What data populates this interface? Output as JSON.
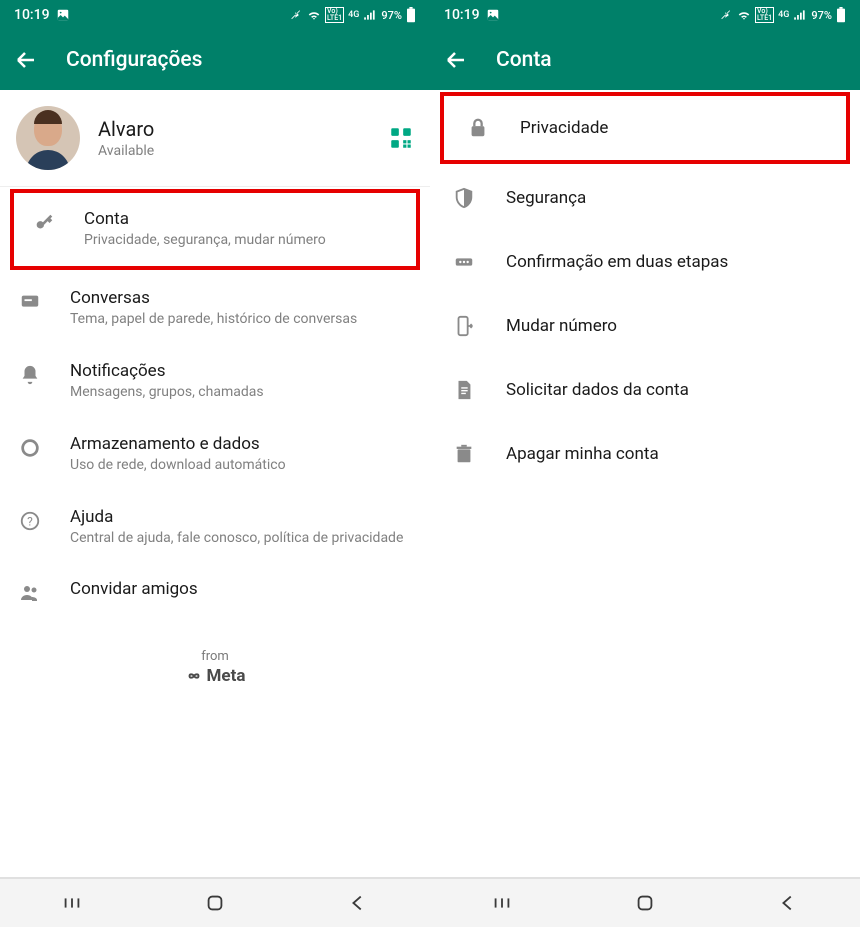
{
  "status": {
    "time": "10:19",
    "battery": "97%"
  },
  "left": {
    "title": "Configurações",
    "profile": {
      "name": "Alvaro",
      "status": "Available"
    },
    "items": [
      {
        "title": "Conta",
        "sub": "Privacidade, segurança, mudar número"
      },
      {
        "title": "Conversas",
        "sub": "Tema, papel de parede, histórico de conversas"
      },
      {
        "title": "Notificações",
        "sub": "Mensagens, grupos, chamadas"
      },
      {
        "title": "Armazenamento e dados",
        "sub": "Uso de rede, download automático"
      },
      {
        "title": "Ajuda",
        "sub": "Central de ajuda, fale conosco, política de privacidade"
      },
      {
        "title": "Convidar amigos",
        "sub": ""
      }
    ],
    "footer": {
      "from": "from",
      "meta": "Meta"
    }
  },
  "right": {
    "title": "Conta",
    "items": [
      {
        "title": "Privacidade"
      },
      {
        "title": "Segurança"
      },
      {
        "title": "Confirmação em duas etapas"
      },
      {
        "title": "Mudar número"
      },
      {
        "title": "Solicitar dados da conta"
      },
      {
        "title": "Apagar minha conta"
      }
    ]
  }
}
